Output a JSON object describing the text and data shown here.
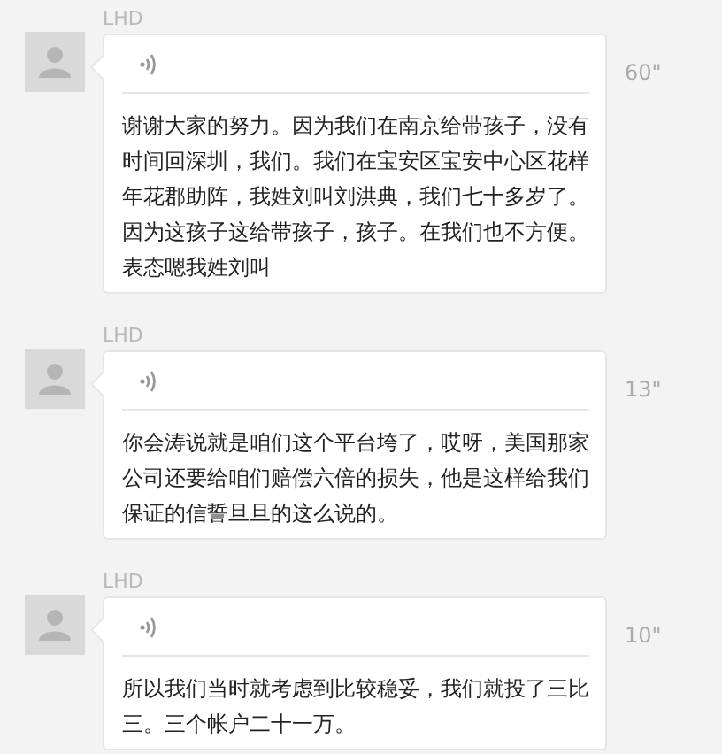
{
  "messages": [
    {
      "sender": "LHD",
      "duration": "60\"",
      "lines": [
        "谢谢大家的努力。因为我们在南京给带孩子，没有",
        "时间回深圳，我们。我们在宝安区宝安中心区花样",
        "年花郡助阵，我姓刘叫刘洪典，我们七十多岁了。",
        "因为这孩子这给带孩子，孩子。在我们也不方便。",
        "表态嗯我姓刘叫"
      ]
    },
    {
      "sender": "LHD",
      "duration": "13\"",
      "lines": [
        "你会涛说就是咱们这个平台垮了，哎呀，美国那家",
        "公司还要给咱们赔偿六倍的损失，他是这样给我们",
        "保证的信誓旦旦的这么说的。"
      ]
    },
    {
      "sender": "LHD",
      "duration": "10\"",
      "lines": [
        "所以我们当时就考虑到比较稳妥，我们就投了三比",
        "三。三个帐户二十一万。"
      ]
    }
  ]
}
